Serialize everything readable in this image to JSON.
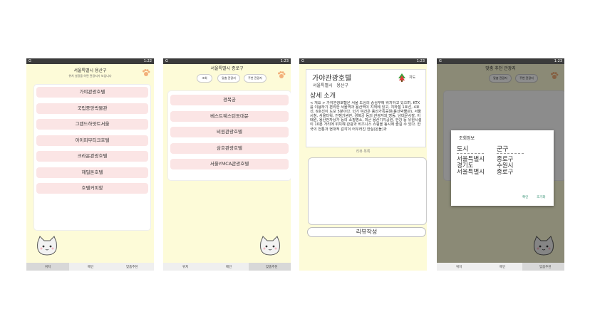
{
  "status": {
    "time1": "1:22",
    "time2": "1:23",
    "time3": "1:23",
    "time4": "1:23",
    "app_letter": "G"
  },
  "screen1": {
    "title": "서울특별시 용산구",
    "subtitle": "위치 설정을 하면 관광지가 보입니다",
    "items": [
      "가야관광호텔",
      "국립중앙박물관",
      "그랜드하얏트서울",
      "아이피부티크호텔",
      "크라운관광호텔",
      "해밀톤호텔",
      "호텔커피할"
    ],
    "nav": [
      "위치",
      "메인",
      "맞춤추천"
    ]
  },
  "screen2": {
    "title": "서울특별시 종로구",
    "buttons": [
      "조회",
      "맞춤 관광지",
      "주변 관광지"
    ],
    "items": [
      "경복궁",
      "베스트웨스턴동대문",
      "비원관광호텔",
      "삼호관광호텔",
      "서울YMCA관광호텔"
    ],
    "nav": [
      "위치",
      "메인",
      "맞춤추천"
    ]
  },
  "screen3": {
    "title": "가야관광호텔",
    "location": "서울특별시   용산구",
    "map_label": "지도",
    "section": "상세 소개",
    "description": "< 개요 >      가야관광호텔은 서울 도심의 중심부에 위치하고 있으며, KTX를 이용하기 편리한 서울역과 용산역이 지척에 있고, 지하철 1호선, 4호선, 6호선이 도보 5분이다.      인기 여건은 용산가족공원(용산박물관), 서울시청, 서울타워, 전쟁기념관, 경복궁 등의 관광지와 명동, 남대문시장, 이태원, 용산전자상가 등의 쇼핑명소, 미군 용산기지공원, 한강 등 유원시설이 10분 거리에 위치해 관광과 비즈니스 쇼핑을 동시에 즐길 수 있다. 한국의 전통과 현대적 감각이 어우러진 한실(온돌)과",
    "review_label": "리뷰 목록",
    "review_button": "리뷰작성"
  },
  "screen4": {
    "title": "맞춤 추천 관광지",
    "buttons": [
      "맞춤 관광지",
      "주변 관광지"
    ],
    "dialog_title": "조회정보",
    "col1_header": "도시",
    "col2_header": "군구",
    "col1": [
      "서울특별시",
      "경기도",
      "서울특별시"
    ],
    "col2": [
      "종로구",
      "수원시",
      "종로구"
    ],
    "confirm": "확인",
    "reset": "초기화",
    "nav": [
      "위치",
      "메인",
      "맞춤추천"
    ]
  },
  "colors": {
    "background": "#fdfbd8",
    "item": "#fbe5e5",
    "status_bar": "#3b3b3b",
    "accent_red": "#e23b3b"
  }
}
